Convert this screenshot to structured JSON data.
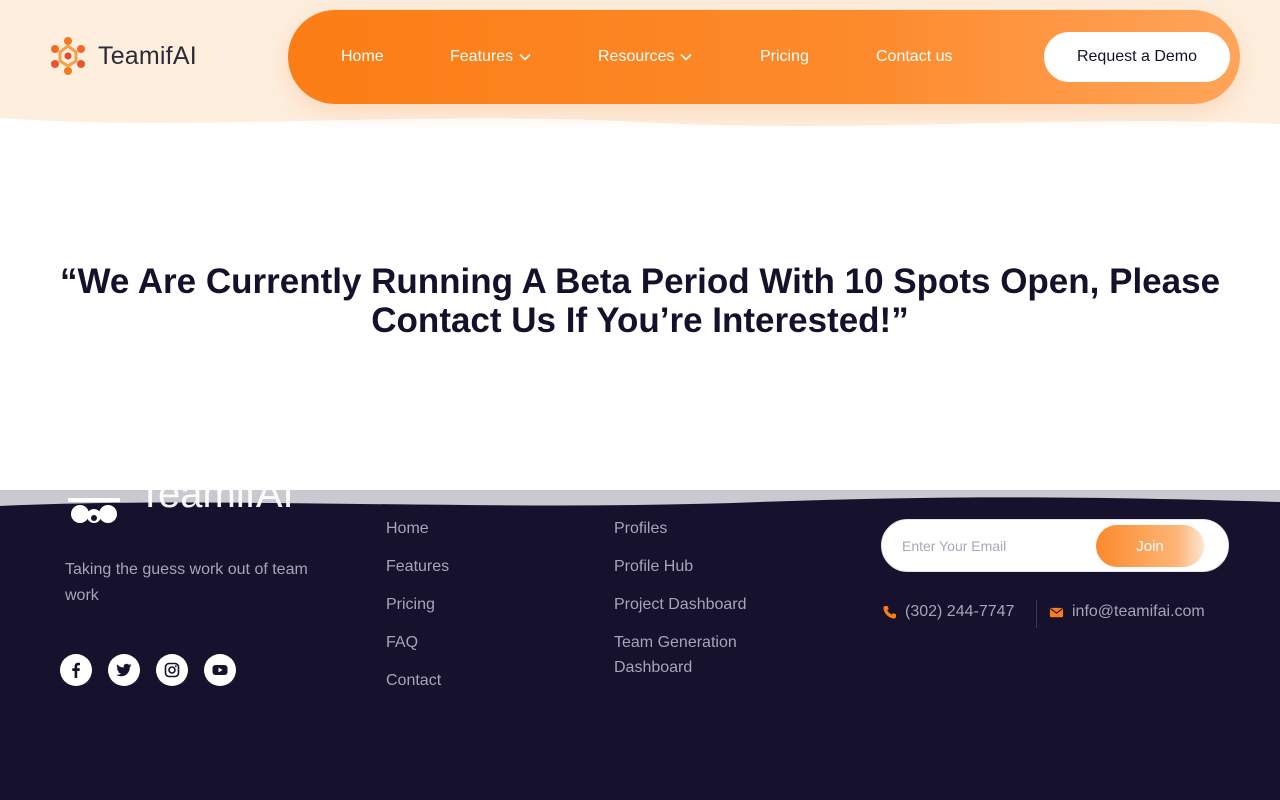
{
  "brand": {
    "name": "TeamifAI",
    "accent": "#fb7d15",
    "dark": "#16112d"
  },
  "nav": {
    "items": [
      {
        "label": "Home",
        "has_dropdown": false
      },
      {
        "label": "Features",
        "has_dropdown": true
      },
      {
        "label": "Resources",
        "has_dropdown": true
      },
      {
        "label": "Pricing",
        "has_dropdown": false
      },
      {
        "label": "Contact us",
        "has_dropdown": false
      }
    ],
    "cta_label": "Request a Demo"
  },
  "hero": {
    "quote": "“We Are Currently Running A Beta Period With 10 Spots Open, Please Contact Us If You’re Interested!”"
  },
  "footer": {
    "brand_name": "TeamifAI",
    "tagline": "Taking the guess work out of team work",
    "social_icons": [
      "facebook-icon",
      "twitter-icon",
      "instagram-icon",
      "youtube-icon"
    ],
    "links_col1": [
      "Home",
      "Features",
      "Pricing",
      "FAQ",
      "Contact"
    ],
    "links_col2": [
      "Profiles",
      "Profile Hub",
      "Project Dashboard",
      "Team Generation Dashboard"
    ],
    "newsletter": {
      "placeholder": "Enter Your Email",
      "button_label": "Join"
    },
    "phone": "(302) 244-7747",
    "email": "info@teamifai.com"
  }
}
